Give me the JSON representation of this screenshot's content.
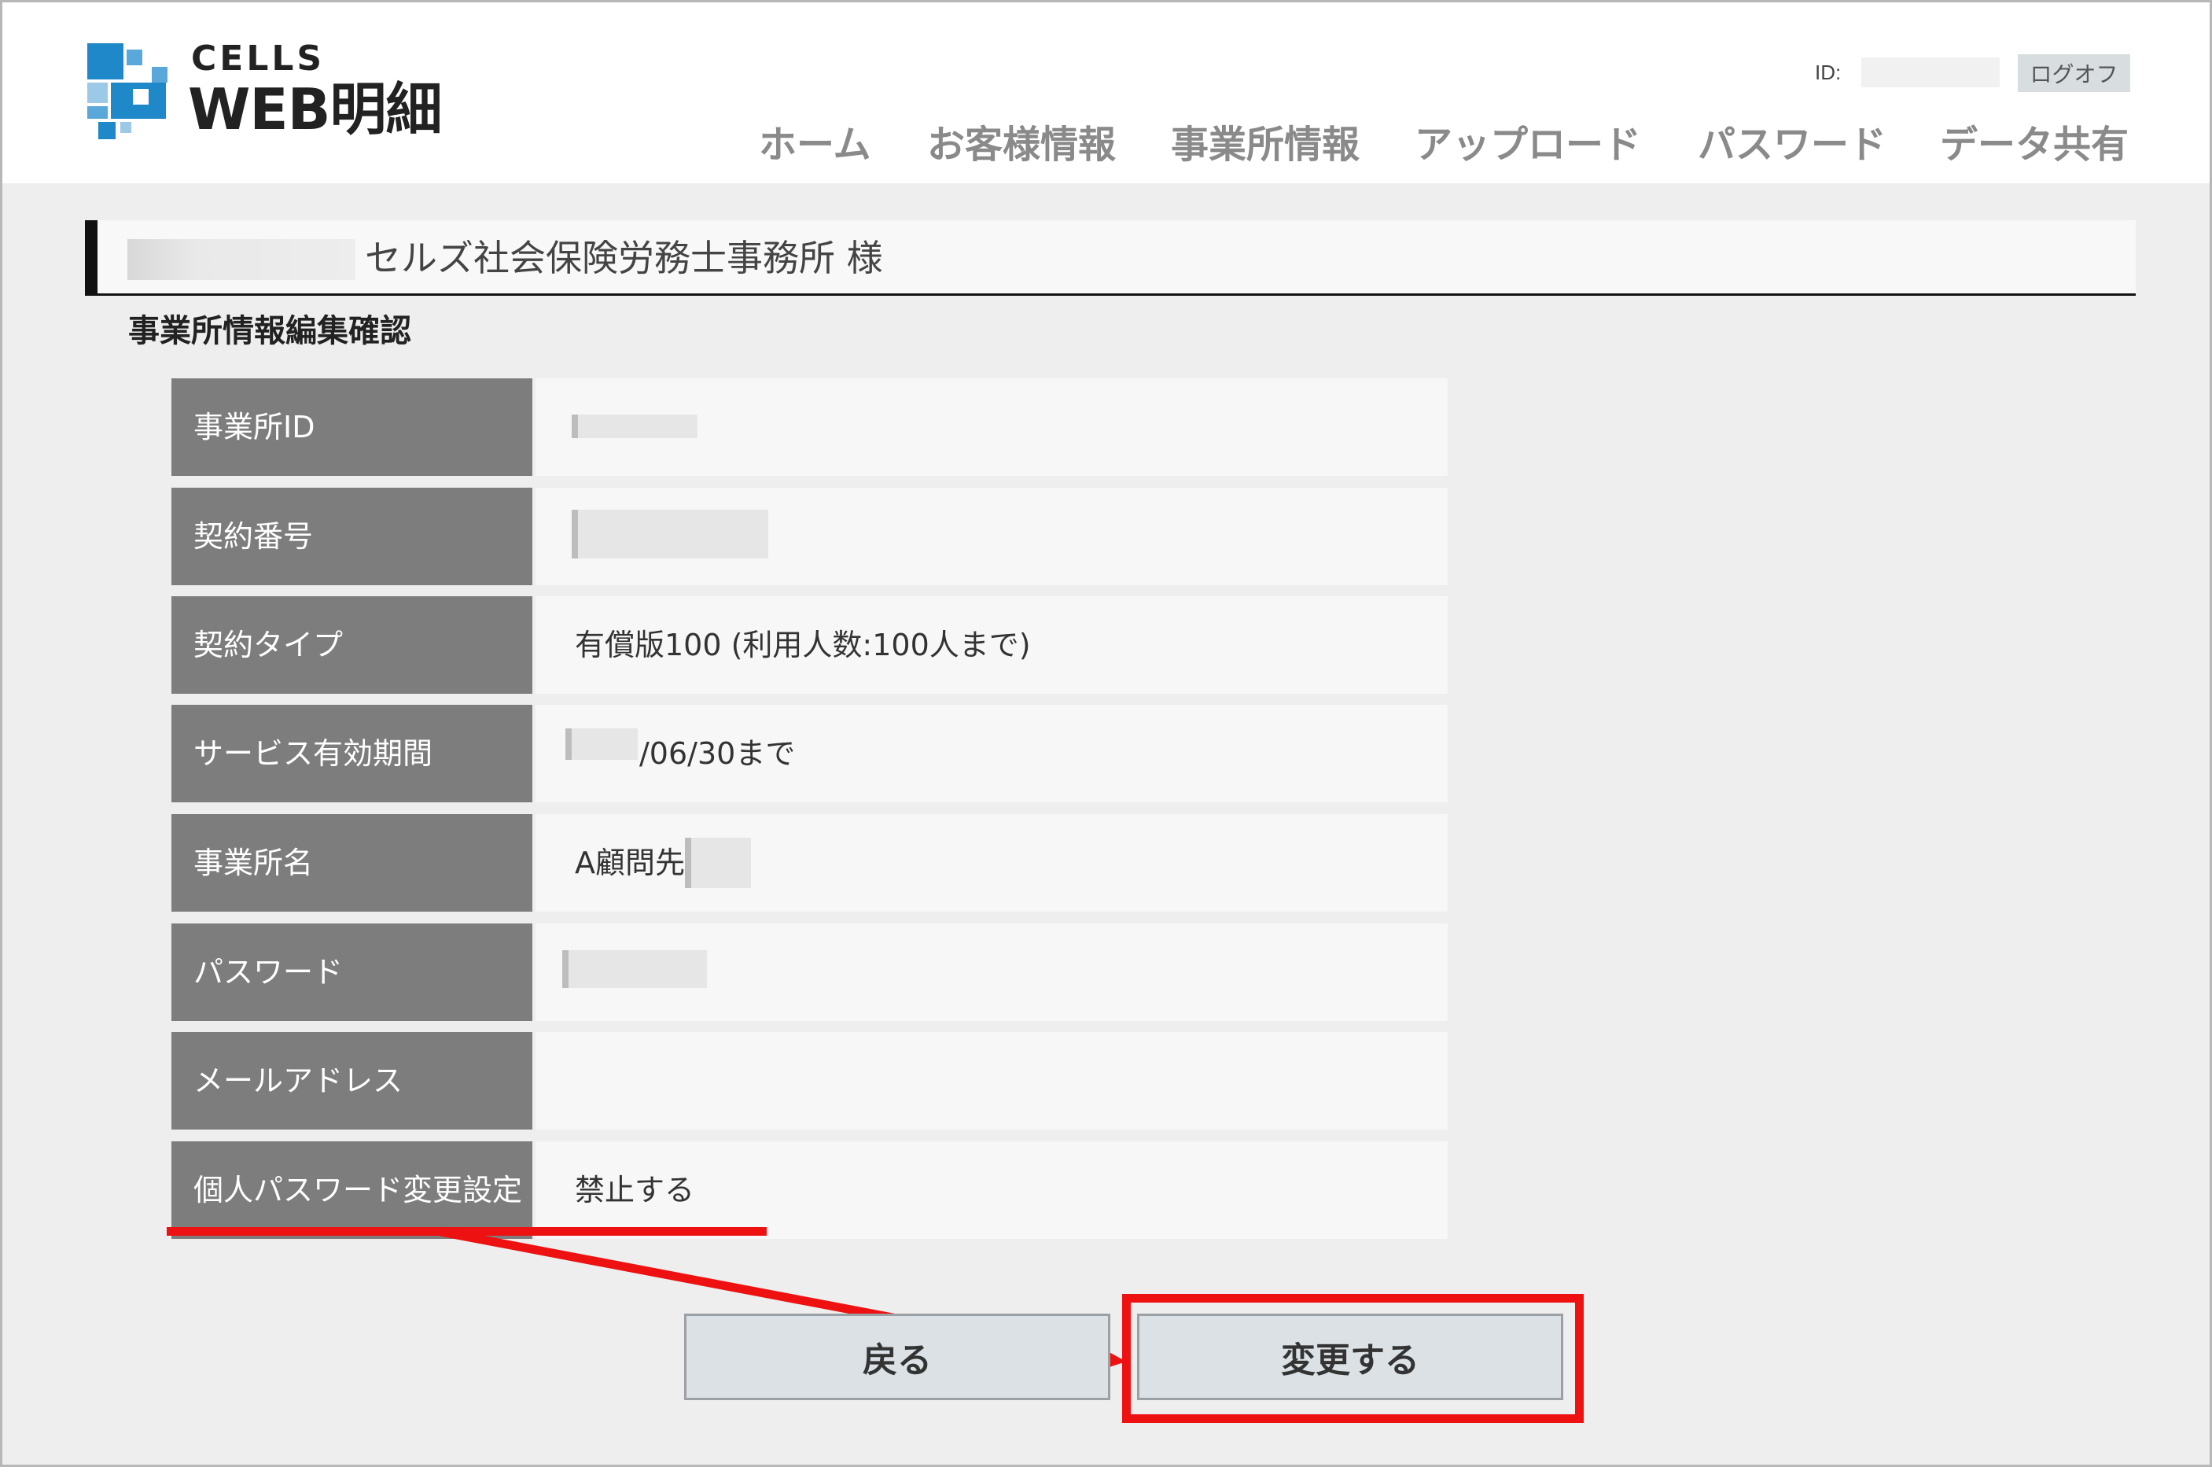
{
  "header": {
    "logo_top": "CELLS",
    "logo_main": "WEB明細",
    "id_label": "ID:",
    "logoff_label": "ログオフ"
  },
  "nav": {
    "items": [
      {
        "label": "ホーム"
      },
      {
        "label": "お客様情報"
      },
      {
        "label": "事業所情報"
      },
      {
        "label": "アップロード"
      },
      {
        "label": "パスワード"
      },
      {
        "label": "データ共有"
      }
    ]
  },
  "office": {
    "name": "セルズ社会保険労務士事務所 様"
  },
  "section_title": "事業所情報編集確認",
  "table": {
    "rows": [
      {
        "label": "事業所ID",
        "value": ""
      },
      {
        "label": "契約番号",
        "value": ""
      },
      {
        "label": "契約タイプ",
        "value": "有償版100 (利用人数:100人まで)"
      },
      {
        "label": "サービス有効期間",
        "value": "/06/30まで"
      },
      {
        "label": "事業所名",
        "value": "A顧問先"
      },
      {
        "label": "パスワード",
        "value": ""
      },
      {
        "label": "メールアドレス",
        "value": ""
      },
      {
        "label": "個人パスワード変更設定",
        "value": "禁止する"
      }
    ]
  },
  "buttons": {
    "back_label": "戻る",
    "change_label": "変更する"
  },
  "colors": {
    "annotation_red": "#ee1111",
    "label_bg": "#7d7d7d",
    "button_bg": "#dbe1e5"
  }
}
